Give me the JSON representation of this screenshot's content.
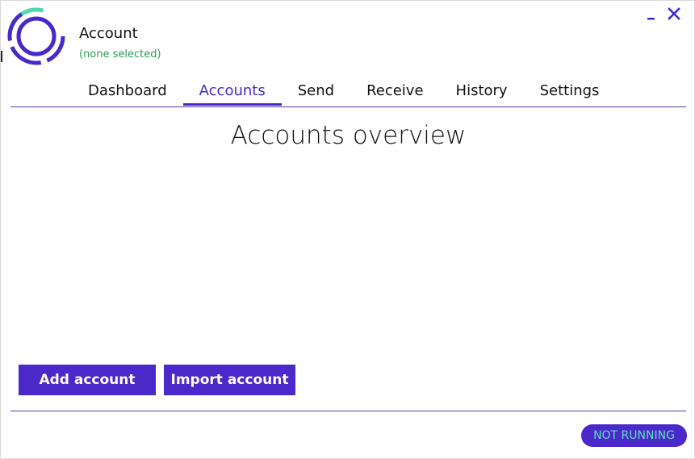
{
  "header": {
    "title": "Account",
    "subtitle": "(none selected)"
  },
  "window_controls": {
    "minimize_icon": "minimize-icon",
    "close_icon": "close-icon"
  },
  "tabs": [
    {
      "label": "Dashboard",
      "active": false
    },
    {
      "label": "Accounts",
      "active": true
    },
    {
      "label": "Send",
      "active": false
    },
    {
      "label": "Receive",
      "active": false
    },
    {
      "label": "History",
      "active": false
    },
    {
      "label": "Settings",
      "active": false
    }
  ],
  "main": {
    "heading": "Accounts overview",
    "add_account_label": "Add account",
    "import_account_label": "Import account"
  },
  "footer": {
    "status": "NOT RUNNING"
  },
  "colors": {
    "accent": "#4a28c9",
    "logo_teal": "#4fd8b0",
    "status_text": "#5ee0c0",
    "subtitle": "#2e9a55"
  }
}
